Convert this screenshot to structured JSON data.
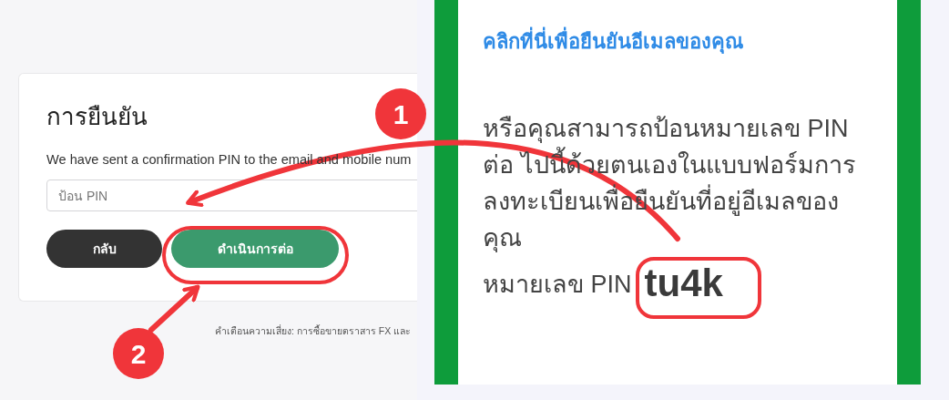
{
  "card": {
    "title": "การยืนยัน",
    "message": "We have sent a confirmation PIN to the email and mobile num",
    "pin_field": {
      "placeholder": "ป้อน PIN"
    },
    "buttons": [
      {
        "label": "กลับ",
        "kind": "back"
      },
      {
        "label": "ดำเนินการต่อ",
        "kind": "continue"
      }
    ],
    "risk_warning": "คำเตือนความเสี่ยง: การซื้อขายตราสาร FX และ"
  },
  "email": {
    "link": "คลิกที่นี่เพื่อยืนยันอีเมลของคุณ",
    "paragraph": "หรือคุณสามารถป้อนหมายเลข PIN ต่อ ไปนี้ด้วยตนเองในแบบฟอร์มการลงทะเบียนเพื่อยืนยันที่อยู่อีเมลของคุณ",
    "pin_label": "หมายเลข PIN",
    "pin": "tu4k"
  },
  "annotations": [
    {
      "label": "1"
    },
    {
      "label": "2"
    }
  ]
}
